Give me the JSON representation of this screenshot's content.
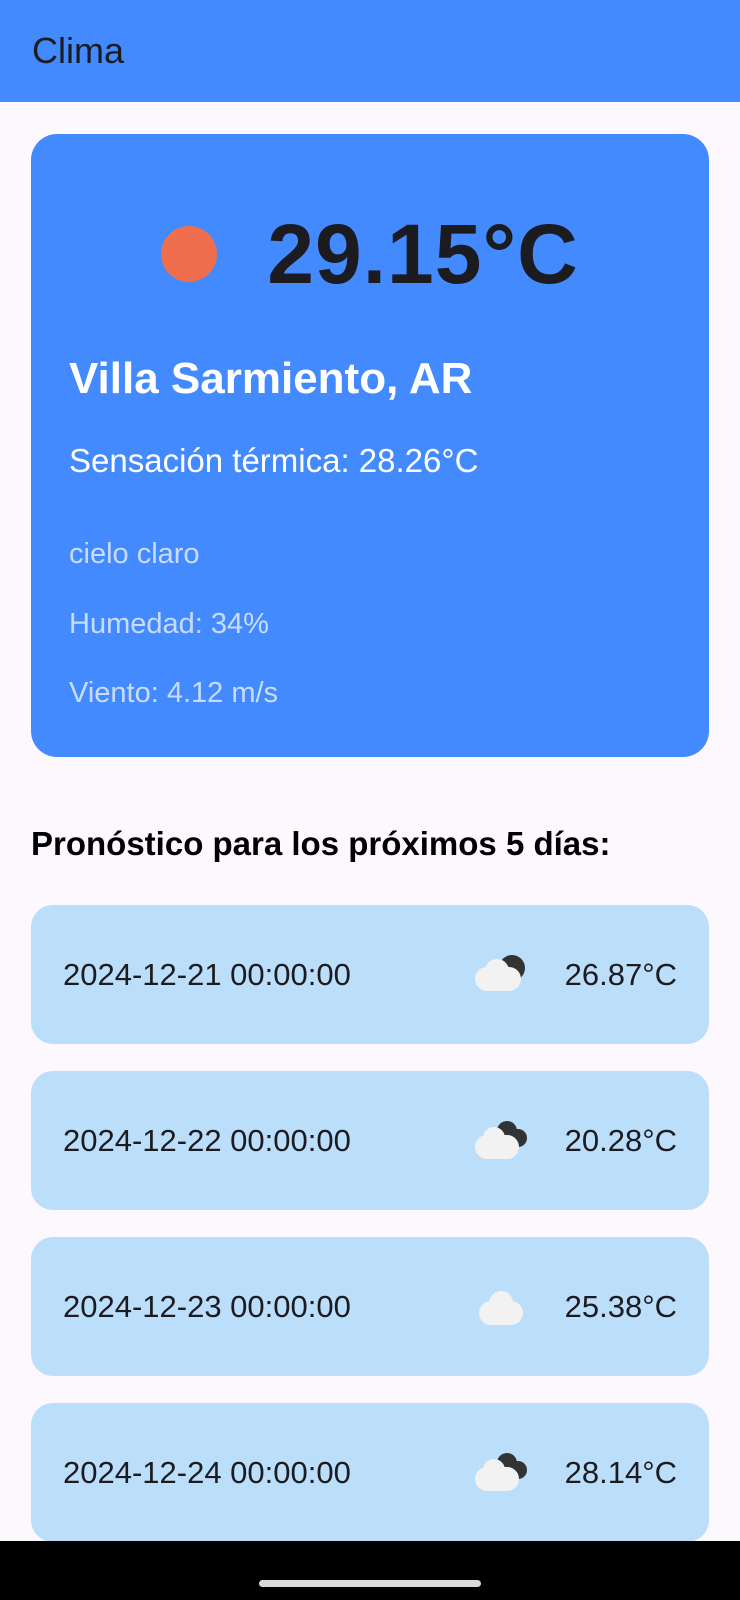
{
  "app_bar": {
    "title": "Clima"
  },
  "current": {
    "icon": "sun-icon",
    "temperature": "29.15°C",
    "city": "Villa Sarmiento, AR",
    "feels_like": "Sensación térmica: 28.26°C",
    "description": "cielo claro",
    "humidity": "Humedad: 34%",
    "wind": "Viento: 4.12 m/s"
  },
  "forecast": {
    "title": "Pronóstico para los próximos 5 días:",
    "items": [
      {
        "date": "2024-12-21 00:00:00",
        "icon": "cloud-moon-icon",
        "temp": "26.87°C"
      },
      {
        "date": "2024-12-22 00:00:00",
        "icon": "broken-clouds-icon",
        "temp": "20.28°C"
      },
      {
        "date": "2024-12-23 00:00:00",
        "icon": "cloud-icon",
        "temp": "25.38°C"
      },
      {
        "date": "2024-12-24 00:00:00",
        "icon": "broken-clouds-icon",
        "temp": "28.14°C"
      }
    ]
  },
  "colors": {
    "primary": "#448AFF",
    "forecast_card": "#BBDEFB",
    "background": "#FDF7FE",
    "sun": "#EE6E4E"
  }
}
